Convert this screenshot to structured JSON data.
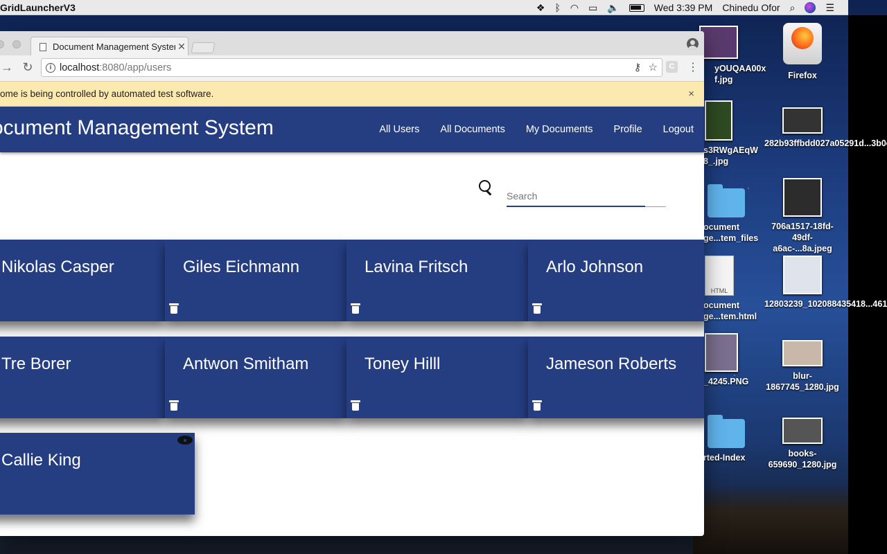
{
  "menubar": {
    "app_name": "GridLauncherV3",
    "clock": "Wed 3:39 PM",
    "user": "Chinedu Ofor"
  },
  "desktop": {
    "icons": [
      {
        "label": "yOUQAA00x f.jpg"
      },
      {
        "label": "Firefox"
      },
      {
        "label": "s3RWgAEqW 8_.jpg"
      },
      {
        "label": "282b93ffbdd027a05291d...3b0e.jpg"
      },
      {
        "label": "ocument ge...tem_files"
      },
      {
        "label": "706a1517-18fd-49df-a6ac-...8a.jpeg"
      },
      {
        "label": "ocument ge...tem.html"
      },
      {
        "label": "12803239_102088435418...461_n.jpg"
      },
      {
        "label": "_4245.PNG"
      },
      {
        "label": "blur-1867745_1280.jpg"
      },
      {
        "label": "rted-Index"
      },
      {
        "label": "books-659690_1280.jpg"
      }
    ],
    "html_badge": "HTML"
  },
  "browser": {
    "tab_title": "Document Management Syster",
    "url_host": "localhost",
    "url_path": ":8080/app/users",
    "ext_label": "C",
    "infobar_text": "ome is being controlled by automated test software."
  },
  "app": {
    "brand": "ocument Management System",
    "nav": [
      "All Users",
      "All Documents",
      "My Documents",
      "Profile",
      "Logout"
    ],
    "search_placeholder": "Search",
    "users": [
      "Nikolas Casper",
      "Giles Eichmann",
      "Lavina Fritsch",
      "Arlo Johnson",
      "Tre Borer",
      "Antwon Smitham",
      "Toney Hilll",
      "Jameson Roberts",
      "Callie King"
    ]
  }
}
